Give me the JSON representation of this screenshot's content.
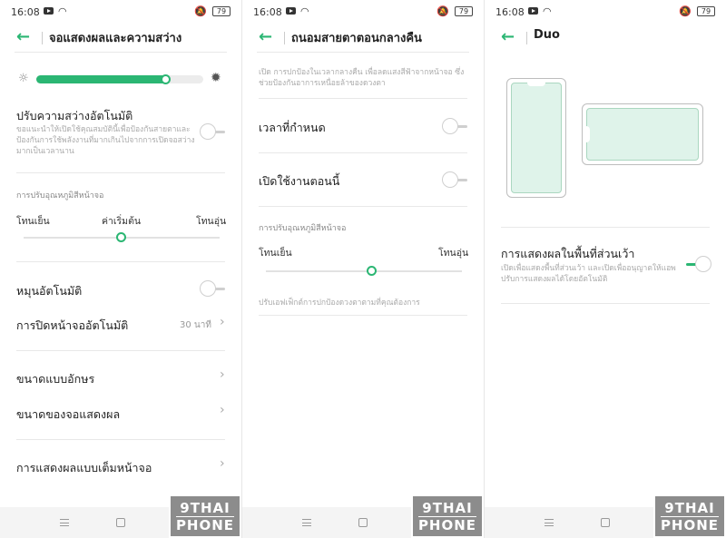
{
  "status": {
    "time": "16:08",
    "battery": "79"
  },
  "screen1": {
    "title": "จอแสดงผลและความสว่าง",
    "brightness_level": 0.78,
    "auto_brightness_title": "ปรับความสว่างอัตโนมัติ",
    "auto_brightness_desc": "ขอแนะนำให้เปิดใช้คุณสมบัตินี้เพื่อป้องกันสายตาและป้องกันการใช้พลังงานที่มากเกินไปจากการเปิดจอสว่างมากเป็นเวลานาน",
    "color_temp_caption": "การปรับอุณหภูมิสีหน้าจอ",
    "cool_label": "โทนเย็น",
    "default_label": "ค่าเริ่มต้น",
    "warm_label": "โทนอุ่น",
    "auto_rotate": "หมุนอัตโนมัติ",
    "auto_screen_off": "การปิดหน้าจออัตโนมัติ",
    "auto_screen_off_value": "30 นาที",
    "font_size": "ขนาดแบบอักษร",
    "display_size": "ขนาดของจอแสดงผล",
    "fullscreen_display": "การแสดงผลแบบเต็มหน้าจอ"
  },
  "screen2": {
    "title": "ถนอมสายตาตอนกลางคืน",
    "description": "เปิด การปกป้องในเวลากลางคืน เพื่อลดแสงสีฟ้าจากหน้าจอ ซึ่งช่วยป้องกันอาการเหนื่อยล้าของดวงตา",
    "scheduled_time": "เวลาที่กำหนด",
    "turn_on_now": "เปิดใช้งานตอนนี้",
    "color_temp_caption": "การปรับอุณหภูมิสีหน้าจอ",
    "cool_label": "โทนเย็น",
    "warm_label": "โทนอุ่น",
    "slider_level": 0.54,
    "footer_note": "ปรับเอฟเฟ็กต์การปกป้องดวงตาตามที่คุณต้องการ"
  },
  "screen3": {
    "title": "Duo",
    "notch_display_title": "การแสดงผลในพื้นที่ส่วนเว้า",
    "notch_display_desc": "เปิดเพื่อแสดงพื้นที่ส่วนเว้า และเปิดเพื่ออนุญาตให้แอพปรับการแสดงผลได้โดยอัตโนมัติ"
  },
  "watermark": {
    "line1": "9THAI",
    "line2": "PHONE"
  },
  "colors": {
    "accent": "#2bb673",
    "divider": "#e8e8e8",
    "text": "#222222",
    "subtext": "#aaaaaa"
  }
}
